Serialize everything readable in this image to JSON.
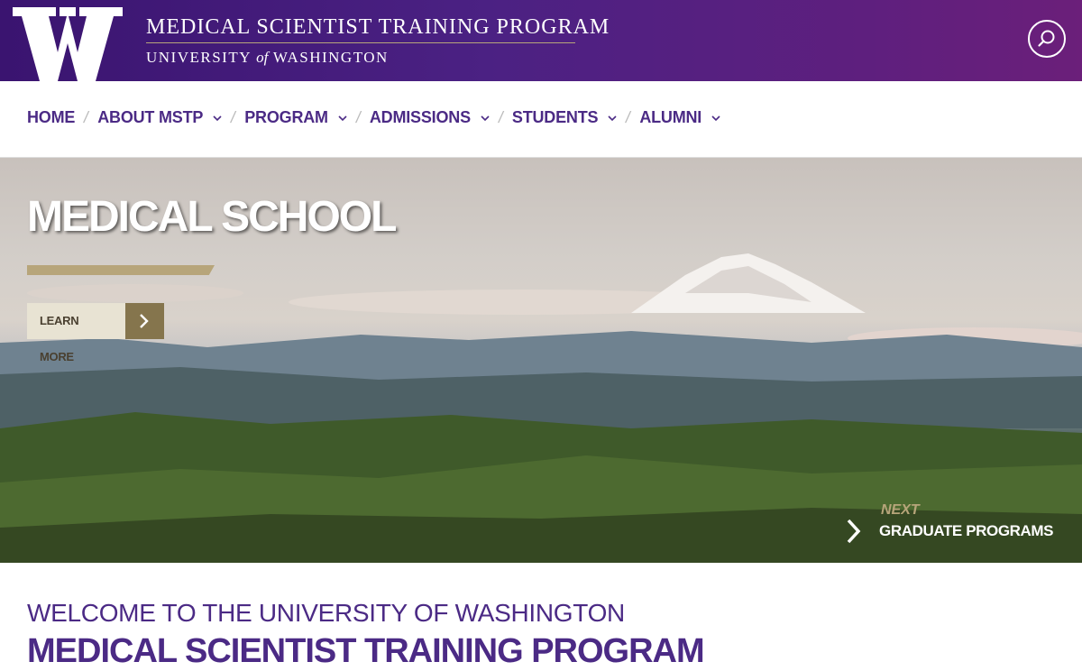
{
  "header": {
    "logo_text": "W",
    "program_title": "MEDICAL SCIENTIST TRAINING PROGRAM",
    "university_prefix": "UNIVERSITY",
    "university_of": "of",
    "university_suffix": "WASHINGTON",
    "search_icon": "search-icon"
  },
  "nav": {
    "items": [
      {
        "label": "HOME",
        "has_dropdown": false
      },
      {
        "label": "ABOUT MSTP",
        "has_dropdown": true
      },
      {
        "label": "PROGRAM",
        "has_dropdown": true
      },
      {
        "label": "ADMISSIONS",
        "has_dropdown": true
      },
      {
        "label": "STUDENTS",
        "has_dropdown": true
      },
      {
        "label": "ALUMNI",
        "has_dropdown": true
      }
    ],
    "separator": "/"
  },
  "hero": {
    "title": "MEDICAL SCHOOL",
    "button_label": "LEARN MORE",
    "next_label": "NEXT",
    "next_title": "GRADUATE PROGRAMS"
  },
  "welcome": {
    "line1": "WELCOME TO THE UNIVERSITY OF WASHINGTON",
    "line2": "MEDICAL SCIENTIST TRAINING PROGRAM"
  },
  "colors": {
    "purple": "#4b2a85",
    "gold": "#b7a57a",
    "header_gradient_start": "#3a1470",
    "header_gradient_end": "#6b1f7a"
  }
}
